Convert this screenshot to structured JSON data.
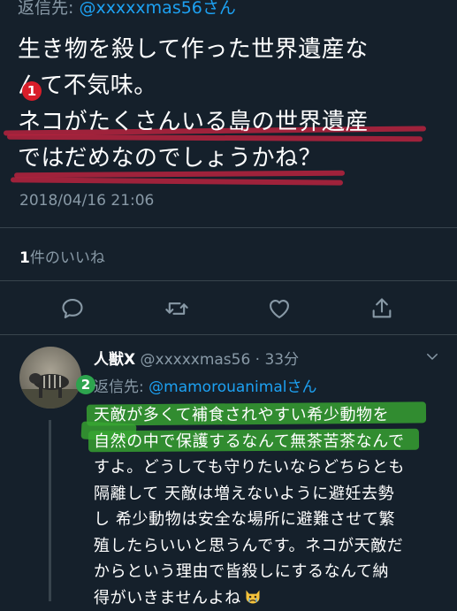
{
  "main_tweet": {
    "reply_prefix": "返信先:",
    "reply_handle": " @xxxxxmas56",
    "reply_suffix": "さん",
    "lines": [
      "生き物を殺して作った世界遺産な",
      "んて不気味。",
      "ネコがたくさんいる島の世界遺産",
      "ではだめなのでしょうかね？"
    ],
    "timestamp": "2018/04/16 21:06",
    "likes_count": "1",
    "likes_label": "件のいいね",
    "annotation_badge": "1"
  },
  "actions": [
    {
      "icon": "reply-icon"
    },
    {
      "icon": "retweet-icon"
    },
    {
      "icon": "like-icon"
    },
    {
      "icon": "share-icon"
    }
  ],
  "reply_tweet": {
    "display_name": "人獣X",
    "meta": " @xxxxxmas56 · 33分",
    "reply_prefix": "返信先:",
    "reply_handle": " @mamorouanimal",
    "reply_suffix": "さん",
    "lines": [
      "天敵が多くて補食されやすい希少動物を",
      "自然の中で保護するなんて無茶苦茶なんで",
      "すよ。どうしても守りたいならどちらとも",
      "隔離して 天敵は増えないように避妊去勢",
      "し 希少動物は安全な場所に避難させて繁",
      "殖したらいいと思うんです。ネコが天敵だ",
      "からという理由で皆殺しにするなんて納",
      "得がいきませんよね"
    ],
    "annotation_badge": "2",
    "emoji": "crying-cat-face-icon"
  },
  "colors": {
    "background": "#15202b",
    "secondary_text": "#8899a6",
    "link": "#1da1f2",
    "divider": "#38444d",
    "red_annotation": "#b3223e",
    "green_highlight": "#38a832"
  }
}
